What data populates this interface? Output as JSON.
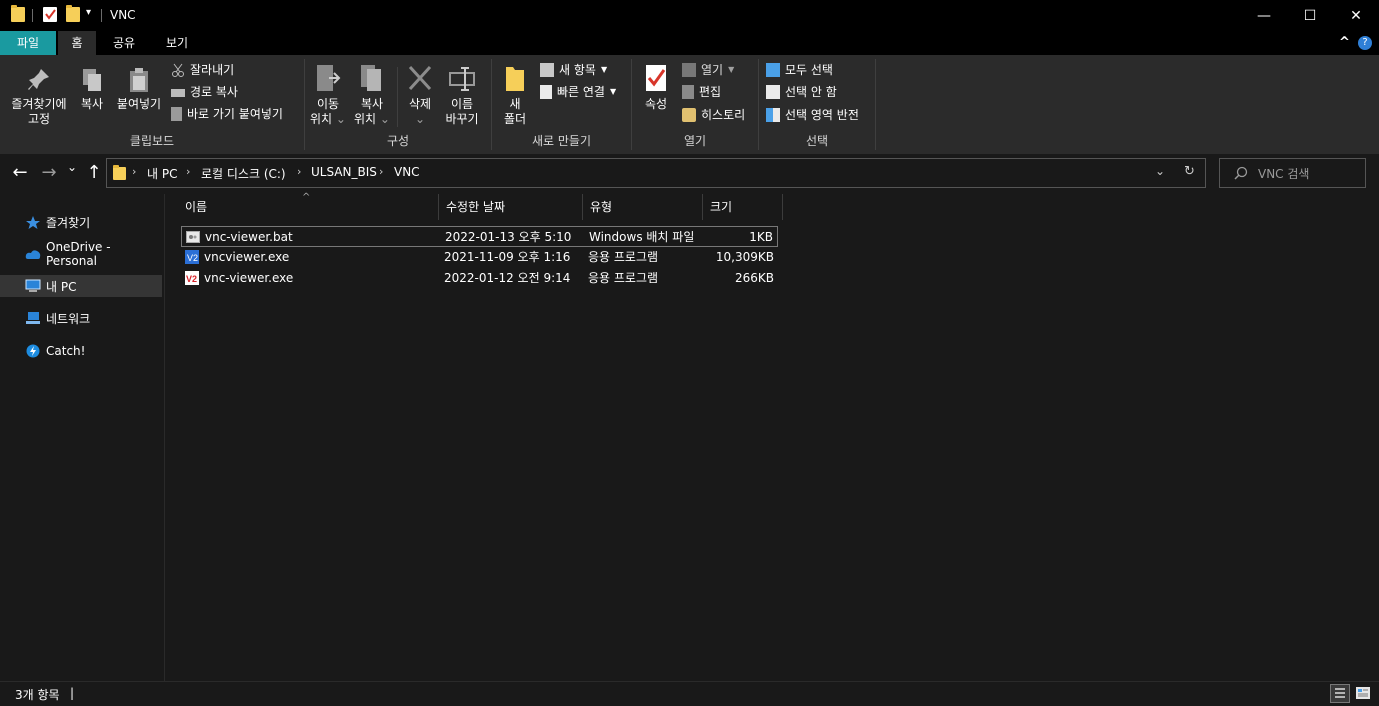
{
  "window": {
    "title": "VNC",
    "minimize": "—",
    "maximize": "☐",
    "close": "✕"
  },
  "quick_access": {
    "dropdown": "▾"
  },
  "tabs": [
    {
      "label": "파일",
      "active_color": "#1a9aa0"
    },
    {
      "label": "홈"
    },
    {
      "label": "공유"
    },
    {
      "label": "보기"
    }
  ],
  "ribbon": {
    "expand_icon": "^",
    "help_icon": "?",
    "clipboard": {
      "group_label": "클립보드",
      "pin_line1": "즐겨찾기에",
      "pin_line2": "고정",
      "copy": "복사",
      "paste": "붙여넣기",
      "cut": "잘라내기",
      "copy_path": "경로 복사",
      "paste_shortcut": "바로 가기 붙여넣기"
    },
    "organize": {
      "group_label": "구성",
      "move_line1": "이동",
      "move_line2": "위치",
      "copyto_line1": "복사",
      "copyto_line2": "위치",
      "delete": "삭제",
      "rename_line1": "이름",
      "rename_line2": "바꾸기"
    },
    "new": {
      "group_label": "새로 만들기",
      "folder_line1": "새",
      "folder_line2": "폴더",
      "new_item": "새 항목",
      "easy_access": "빠른 연결"
    },
    "open": {
      "group_label": "열기",
      "properties": "속성",
      "open": "열기",
      "edit": "편집",
      "history": "히스토리"
    },
    "select": {
      "group_label": "선택",
      "select_all": "모두 선택",
      "select_none": "선택 안 함",
      "invert": "선택 영역 반전"
    }
  },
  "address": {
    "back": "←",
    "forward": "→",
    "recent": "⌄",
    "up": "↑",
    "crumbs": [
      "내 PC",
      "로컬 디스크 (C:)",
      "ULSAN_BIS",
      "VNC"
    ],
    "separator": "›",
    "dropdown": "⌄",
    "refresh": "↻",
    "search_placeholder": "VNC 검색"
  },
  "sidebar": {
    "items": [
      {
        "label": "즐겨찾기",
        "icon": "star-icon"
      },
      {
        "label": "OneDrive - Personal",
        "icon": "cloud-icon"
      },
      {
        "label": "내 PC",
        "icon": "pc-icon",
        "selected": true
      },
      {
        "label": "네트워크",
        "icon": "network-icon"
      },
      {
        "label": "Catch!",
        "icon": "bolt-icon"
      }
    ]
  },
  "files": {
    "sort_indicator": "^",
    "columns": [
      "이름",
      "수정한 날짜",
      "유형",
      "크기"
    ],
    "rows": [
      {
        "name": "vnc-viewer.bat",
        "date": "2022-01-13 오후 5:10",
        "type": "Windows 배치 파일",
        "size": "1KB",
        "icon": "bat-file-icon"
      },
      {
        "name": "vncviewer.exe",
        "date": "2021-11-09 오후 1:16",
        "type": "응용 프로그램",
        "size": "10,309KB",
        "icon": "vnc-blue-icon"
      },
      {
        "name": "vnc-viewer.exe",
        "date": "2022-01-12 오전 9:14",
        "type": "응용 프로그램",
        "size": "266KB",
        "icon": "vnc-red-icon"
      }
    ]
  },
  "status": {
    "count": "3개 항목",
    "cursor": "|"
  }
}
